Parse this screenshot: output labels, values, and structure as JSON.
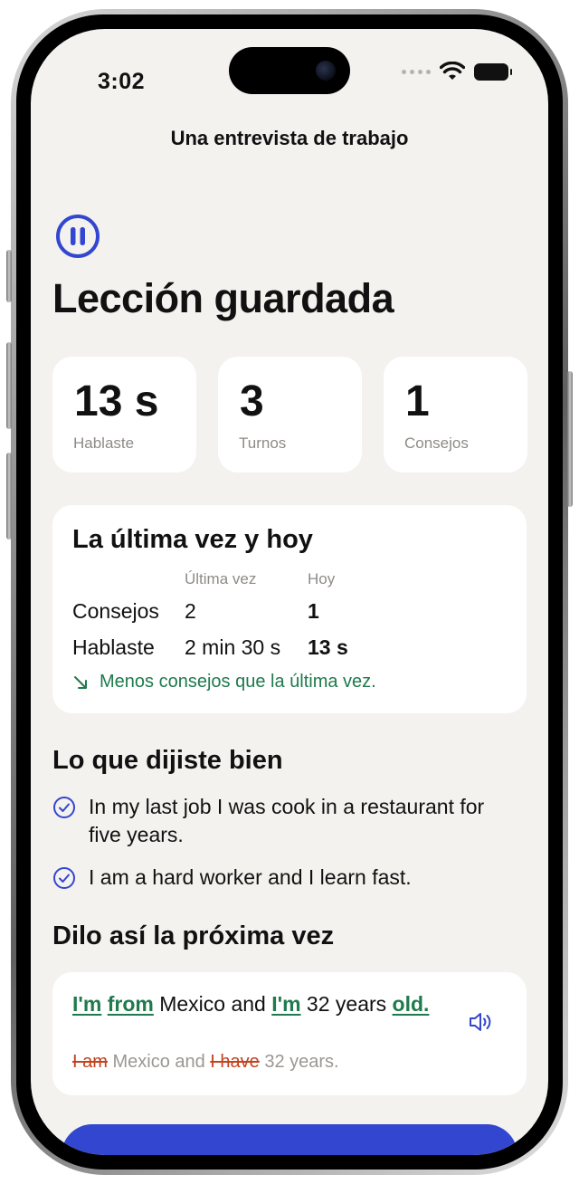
{
  "status_bar": {
    "time": "3:02"
  },
  "nav": {
    "title": "Una entrevista de trabajo"
  },
  "header": {
    "title": "Lección guardada",
    "pause_icon": "pause-icon"
  },
  "stats": [
    {
      "value": "13 s",
      "label": "Hablaste"
    },
    {
      "value": "3",
      "label": "Turnos"
    },
    {
      "value": "1",
      "label": "Consejos"
    }
  ],
  "comparison": {
    "title": "La última vez y hoy",
    "columns": [
      "Última vez",
      "Hoy"
    ],
    "rows": [
      {
        "label": "Consejos",
        "last": "2",
        "today": "1"
      },
      {
        "label": "Hablaste",
        "last": "2 min 30 s",
        "today": "13 s"
      }
    ],
    "trend_text": "Menos consejos que la última vez.",
    "trend_color": "#1f7a4d"
  },
  "good": {
    "title": "Lo que dijiste bien",
    "items": [
      "In my last job I was cook in a restaurant for five years.",
      "I am a hard worker and I learn fast."
    ]
  },
  "next_time": {
    "title": "Dilo así la próxima vez",
    "correct": [
      {
        "text": "I'm",
        "highlight": true
      },
      {
        "text": " ",
        "highlight": false
      },
      {
        "text": "from",
        "highlight": true
      },
      {
        "text": " Mexico and ",
        "highlight": false
      },
      {
        "text": "I'm",
        "highlight": true
      },
      {
        "text": " 32 years ",
        "highlight": false
      },
      {
        "text": "old.",
        "highlight": true
      }
    ],
    "wrong": [
      {
        "text": "I am",
        "strike": true
      },
      {
        "text": " Mexico and ",
        "strike": false
      },
      {
        "text": "I have",
        "strike": true
      },
      {
        "text": " 32 years.",
        "strike": false
      }
    ]
  },
  "colors": {
    "accent": "#3346cf",
    "good": "#1f7a4d",
    "error": "#c2421d",
    "background": "#f4f2ef"
  }
}
